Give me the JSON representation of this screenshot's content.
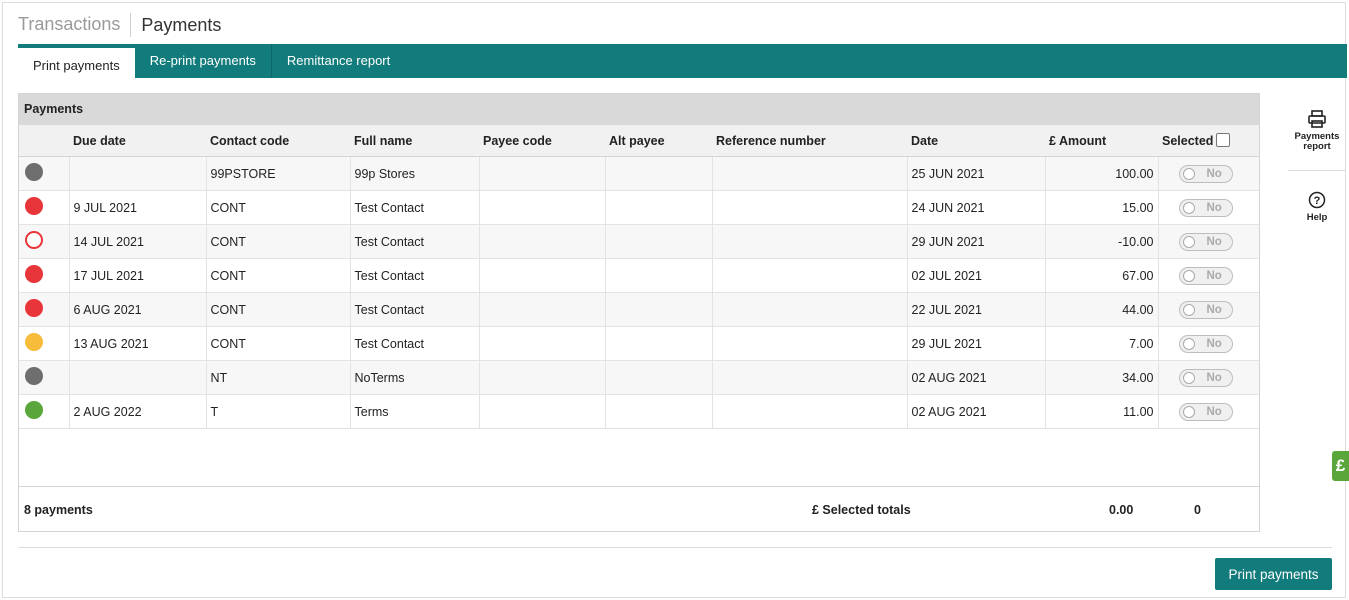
{
  "header": {
    "breadcrumb_parent": "Transactions",
    "title": "Payments"
  },
  "tabs": [
    {
      "label": "Print payments",
      "active": true
    },
    {
      "label": "Re-print payments",
      "active": false
    },
    {
      "label": "Remittance report",
      "active": false
    }
  ],
  "panel": {
    "title": "Payments",
    "columns": {
      "due_date": "Due date",
      "contact_code": "Contact code",
      "full_name": "Full name",
      "payee_code": "Payee code",
      "alt_payee": "Alt payee",
      "reference_number": "Reference number",
      "date": "Date",
      "amount": "£ Amount",
      "selected": "Selected"
    },
    "rows": [
      {
        "status_color": "#6e6e6e",
        "status_fill": "solid",
        "due_date": "",
        "contact_code": "99PSTORE",
        "full_name": "99p Stores",
        "payee_code": "",
        "alt_payee": "",
        "reference_number": "",
        "date": "25 JUN 2021",
        "amount": "100.00",
        "selected": "No"
      },
      {
        "status_color": "#e8353a",
        "status_fill": "solid",
        "due_date": "9 JUL 2021",
        "contact_code": "CONT",
        "full_name": "Test Contact",
        "payee_code": "",
        "alt_payee": "",
        "reference_number": "",
        "date": "24 JUN 2021",
        "amount": "15.00",
        "selected": "No"
      },
      {
        "status_color": "#e8353a",
        "status_fill": "outline",
        "due_date": "14 JUL 2021",
        "contact_code": "CONT",
        "full_name": "Test Contact",
        "payee_code": "",
        "alt_payee": "",
        "reference_number": "",
        "date": "29 JUN 2021",
        "amount": "-10.00",
        "selected": "No"
      },
      {
        "status_color": "#e8353a",
        "status_fill": "solid",
        "due_date": "17 JUL 2021",
        "contact_code": "CONT",
        "full_name": "Test Contact",
        "payee_code": "",
        "alt_payee": "",
        "reference_number": "",
        "date": "02 JUL 2021",
        "amount": "67.00",
        "selected": "No"
      },
      {
        "status_color": "#e8353a",
        "status_fill": "solid",
        "due_date": "6 AUG 2021",
        "contact_code": "CONT",
        "full_name": "Test Contact",
        "payee_code": "",
        "alt_payee": "",
        "reference_number": "",
        "date": "22 JUL 2021",
        "amount": "44.00",
        "selected": "No"
      },
      {
        "status_color": "#f7bd3a",
        "status_fill": "solid",
        "due_date": "13 AUG 2021",
        "contact_code": "CONT",
        "full_name": "Test Contact",
        "payee_code": "",
        "alt_payee": "",
        "reference_number": "",
        "date": "29 JUL 2021",
        "amount": "7.00",
        "selected": "No"
      },
      {
        "status_color": "#6e6e6e",
        "status_fill": "solid",
        "due_date": "",
        "contact_code": "NT",
        "full_name": "NoTerms",
        "payee_code": "",
        "alt_payee": "",
        "reference_number": "",
        "date": "02 AUG 2021",
        "amount": "34.00",
        "selected": "No"
      },
      {
        "status_color": "#5aa63a",
        "status_fill": "solid",
        "due_date": "2 AUG 2022",
        "contact_code": "T",
        "full_name": "Terms",
        "payee_code": "",
        "alt_payee": "",
        "reference_number": "",
        "date": "02 AUG 2021",
        "amount": "11.00",
        "selected": "No"
      }
    ],
    "footer": {
      "count_label": "8 payments",
      "totals_label": "£ Selected totals",
      "totals_amount": "0.00",
      "totals_count": "0"
    }
  },
  "sidebar": {
    "payments_report_label": "Payments report",
    "help_label": "Help"
  },
  "pound_tab": "£",
  "actions": {
    "print_label": "Print payments"
  },
  "colors": {
    "accent": "#127b7b",
    "panel_header": "#d9d9d9",
    "pound_tab": "#5aa63a"
  }
}
